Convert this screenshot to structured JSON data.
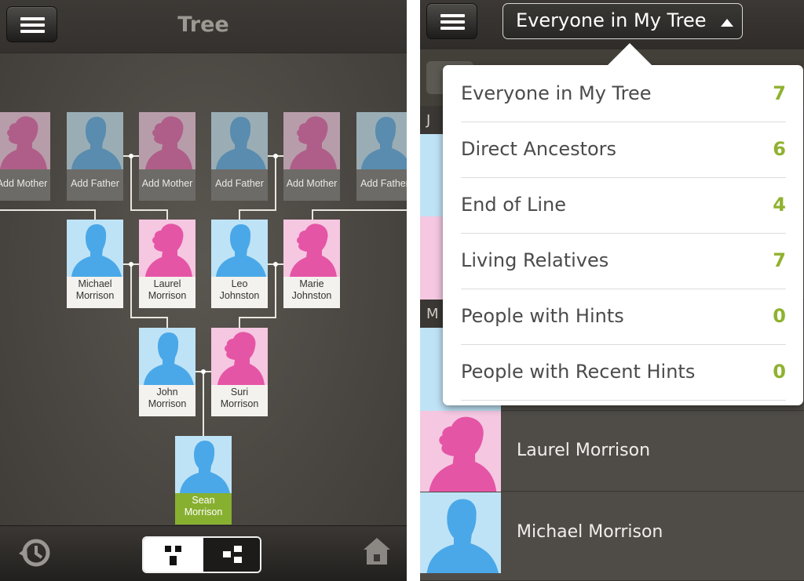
{
  "left": {
    "title": "Tree",
    "colors": {
      "male": "#4aa8e8",
      "male_bg": "#bfe3f6",
      "female": "#e555a6",
      "female_bg": "#f5c7e1",
      "selected": "#88b030"
    },
    "placeholders": [
      {
        "label": "Add Mother",
        "gender": "female"
      },
      {
        "label": "Add Father",
        "gender": "male"
      },
      {
        "label": "Add Mother",
        "gender": "female"
      },
      {
        "label": "Add Father",
        "gender": "male"
      },
      {
        "label": "Add Mother",
        "gender": "female"
      },
      {
        "label": "Add Father",
        "gender": "male"
      }
    ],
    "grandparents": [
      {
        "line1": "Michael",
        "line2": "Morrison",
        "gender": "male"
      },
      {
        "line1": "Laurel",
        "line2": "Morrison",
        "gender": "female"
      },
      {
        "line1": "Leo",
        "line2": "Johnston",
        "gender": "male"
      },
      {
        "line1": "Marie",
        "line2": "Johnston",
        "gender": "female"
      }
    ],
    "parents": [
      {
        "line1": "John",
        "line2": "Morrison",
        "gender": "male"
      },
      {
        "line1": "Suri",
        "line2": "Morrison",
        "gender": "female"
      }
    ],
    "root": {
      "line1": "Sean",
      "line2": "Morrison",
      "gender": "male"
    },
    "bottom": {
      "history_icon": "history-icon",
      "home_icon": "home-icon",
      "view_tree_icon": "tree-view-icon",
      "view_family_icon": "family-view-icon"
    }
  },
  "right": {
    "filter_button": "Everyone in My Tree",
    "dropdown": [
      {
        "label": "Everyone in My Tree",
        "count": "7"
      },
      {
        "label": "Direct Ancestors",
        "count": "6"
      },
      {
        "label": "End of Line",
        "count": "4"
      },
      {
        "label": "Living Relatives",
        "count": "7"
      },
      {
        "label": "People with Hints",
        "count": "0"
      },
      {
        "label": "People with Recent Hints",
        "count": "0"
      }
    ],
    "letters": [
      "J",
      "M"
    ],
    "rows": [
      {
        "name": "Laurel Morrison",
        "gender": "female"
      },
      {
        "name": "Michael Morrison",
        "gender": "male"
      }
    ]
  }
}
